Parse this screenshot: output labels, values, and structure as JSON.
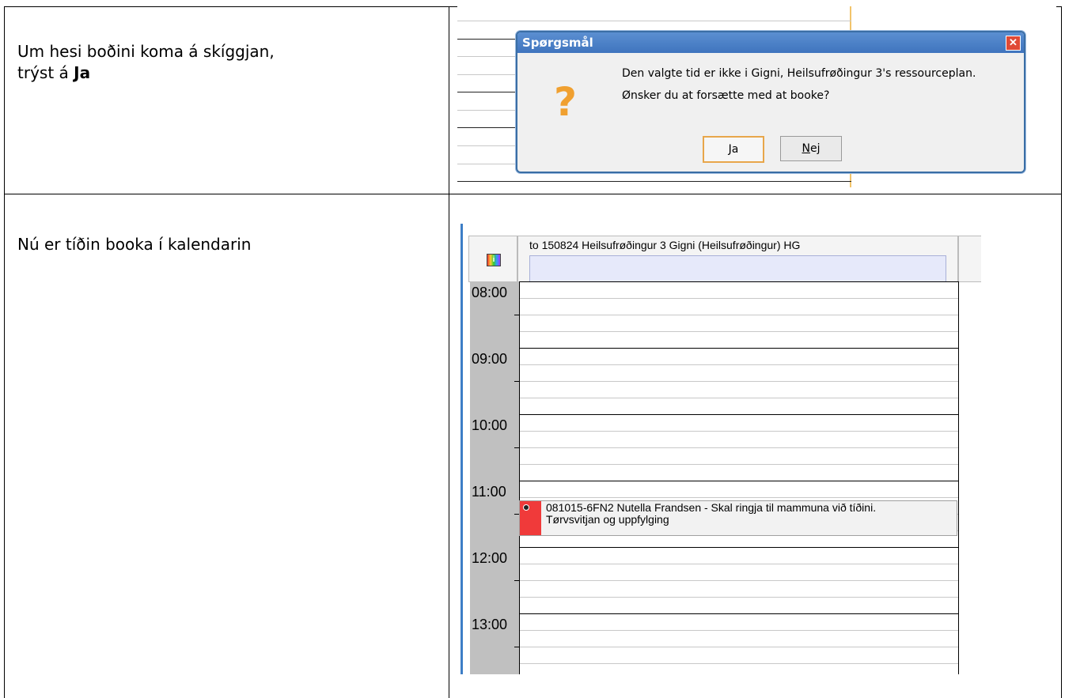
{
  "rows": [
    {
      "instruction_lines": [
        "Um hesi boðini koma á skíggjan,",
        "trýst á "
      ],
      "instruction_bold": "Ja"
    },
    {
      "instruction_lines": [
        "Nú er tíðin booka í kalendarin"
      ]
    }
  ],
  "dialog": {
    "title": "Spørgsmål",
    "message_lines": [
      "Den valgte tid er ikke i Gigni, Heilsufrøðingur 3's ressourceplan.",
      "Ønsker du at forsætte med at booke?"
    ],
    "yes_label": "Ja",
    "no_label": "Nej",
    "close_glyph": "✕",
    "question_glyph": "?"
  },
  "calendar": {
    "header": "to 150824 Heilsufrøðingur 3 Gigni (Heilsufrøðingur) HG",
    "hours": [
      "08:00",
      "09:00",
      "10:00",
      "11:00",
      "12:00",
      "13:00"
    ],
    "event_lines": [
      "081015-6FN2  Nutella Frandsen - Skal ringja til mammuna við tíðini.",
      "Tørvsvitjan og uppfylging"
    ],
    "event_color": "#f03a3a",
    "info_icon": "info-icon"
  }
}
